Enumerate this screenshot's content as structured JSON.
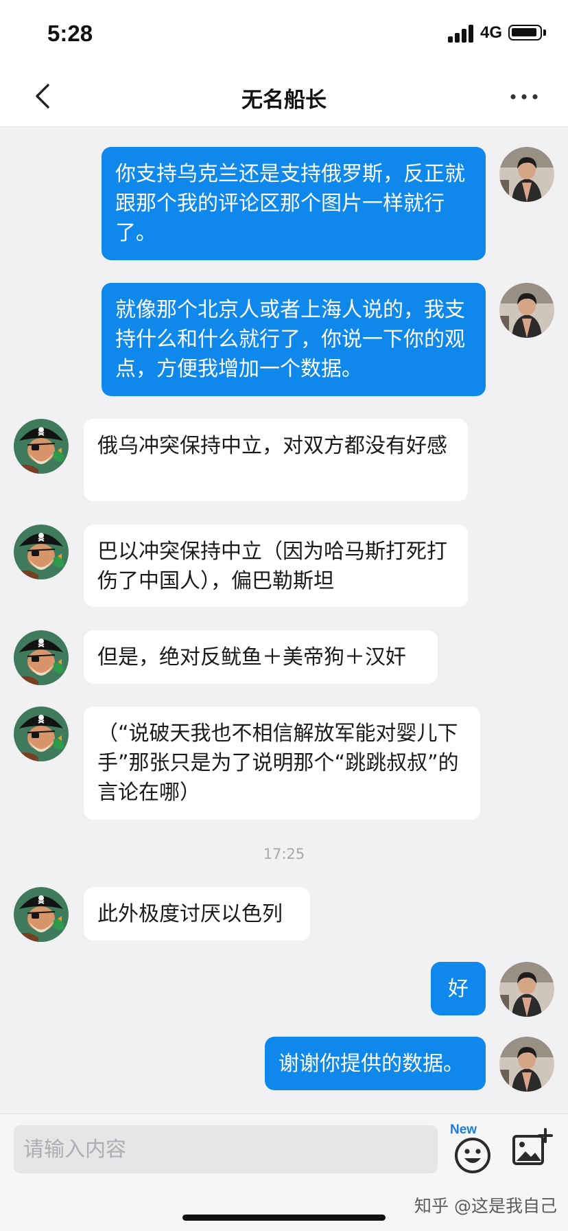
{
  "status_bar": {
    "time": "5:28",
    "network": "4G"
  },
  "header": {
    "title": "无名船长"
  },
  "messages": [
    {
      "side": "right",
      "text": "你支持乌克兰还是支持俄罗斯，反正就跟那个我的评论区那个图片一样就行了。"
    },
    {
      "side": "right",
      "text": "就像那个北京人或者上海人说的，我支持什么和什么就行了，你说一下你的观点，方便我增加一个数据。"
    },
    {
      "side": "left",
      "text": "俄乌冲突保持中立，对双方都没有好感"
    },
    {
      "side": "left",
      "text": "巴以冲突保持中立（因为哈马斯打死打伤了中国人），偏巴勒斯坦"
    },
    {
      "side": "left",
      "text": "但是，绝对反鱿鱼＋美帝狗＋汉奸"
    },
    {
      "side": "left",
      "text": "（“说破天我也不相信解放军能对婴儿下手”那张只是为了说明那个“跳跳叔叔”的言论在哪）"
    },
    {
      "side": "left",
      "text": "此外极度讨厌以色列"
    },
    {
      "side": "right",
      "text": "好"
    },
    {
      "side": "right",
      "text": "谢谢你提供的数据。"
    }
  ],
  "timestamp": "17:25",
  "input": {
    "placeholder": "请输入内容",
    "value": ""
  },
  "emoji_badge": "New",
  "watermark": "知乎 @这是我自己",
  "icons": {
    "back": "chevron-left-icon",
    "more": "more-dots-icon",
    "emoji": "smiley-face-icon",
    "image": "image-add-icon"
  },
  "colors": {
    "outgoing_bubble": "#0f88eb",
    "incoming_bubble": "#ffffff",
    "chat_background": "#f1f1f3",
    "badge": "#1a7ce6"
  }
}
